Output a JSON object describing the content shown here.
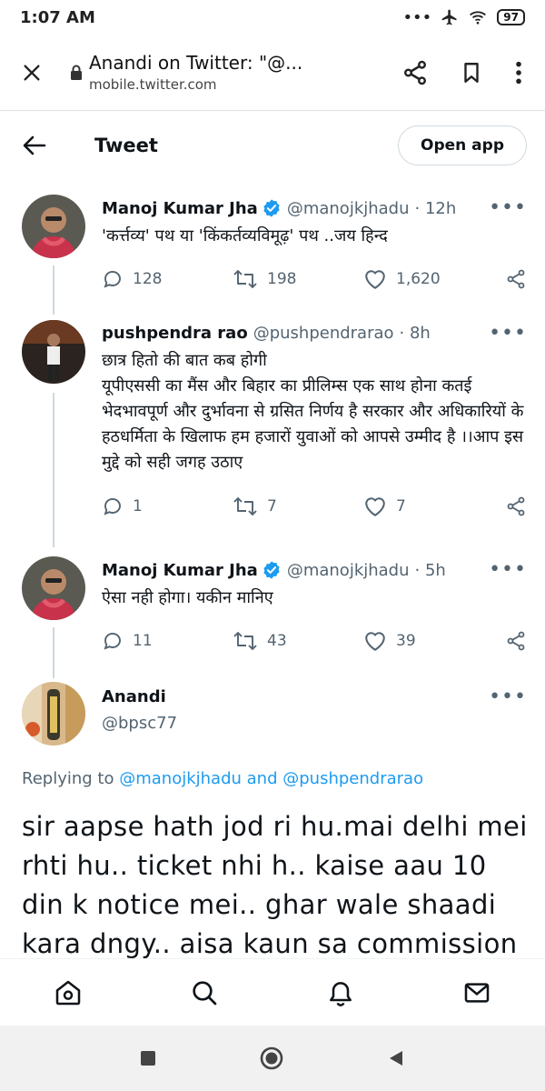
{
  "status_bar": {
    "time": "1:07 AM",
    "battery": "97"
  },
  "browser": {
    "title": "Anandi on Twitter: \"@...",
    "url": "mobile.twitter.com"
  },
  "header": {
    "title": "Tweet",
    "open_app": "Open app"
  },
  "tweets": [
    {
      "name": "Manoj Kumar Jha",
      "handle": "@manojkjhadu",
      "time": "· 12h",
      "text": "'कर्त्तव्य' पथ या 'किंकर्तव्यविमूढ़' पथ ..जय हिन्द",
      "replies": "128",
      "retweets": "198",
      "likes": "1,620"
    },
    {
      "name": "pushpendra rao",
      "handle": "@pushpendrarao",
      "time": "· 8h",
      "text": "छात्र हितो की बात कब होगी\nयूपीएससी का मैंस और बिहार का प्रीलिम्स एक साथ होना कतई भेदभावपूर्ण और दुर्भावना से ग्रसित निर्णय है सरकार और अधिकारियों के हठधर्मिता के खिलाफ हम हजारों युवाओं को आपसे उम्मीद है ।।आप इस मुद्दे को सही जगह उठाए",
      "replies": "1",
      "retweets": "7",
      "likes": "7"
    },
    {
      "name": "Manoj Kumar Jha",
      "handle": "@manojkjhadu",
      "time": "· 5h",
      "text": "ऐसा नही होगा। यकीन मानिए",
      "replies": "11",
      "retweets": "43",
      "likes": "39"
    }
  ],
  "focused": {
    "name": "Anandi",
    "handle": "@bpsc77",
    "replying_prefix": "Replying to",
    "reply_to_1": "@manojkjhadu",
    "reply_and": "and",
    "reply_to_2": "@pushpendrarao",
    "text": "sir aapse hath jod ri hu.mai delhi mei rhti hu.. ticket nhi h.. kaise aau 10 din k notice mei.. ghar wale shaadi kara dngy.. aisa kaun sa commission"
  },
  "colors": {
    "accent": "#1d9bf0",
    "muted": "#536471",
    "text": "#0f1419"
  }
}
